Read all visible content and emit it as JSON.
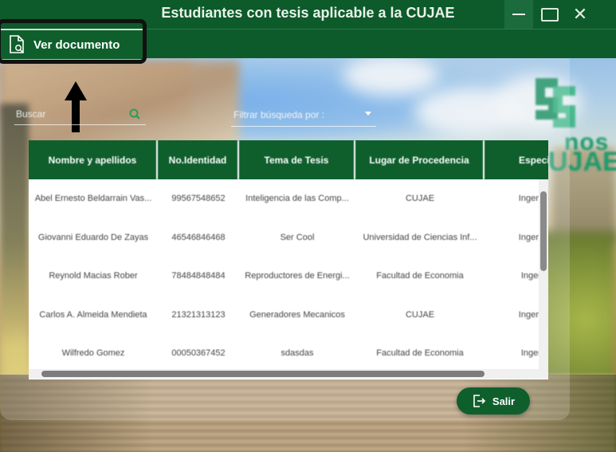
{
  "window": {
    "title": "Estudiantes con tesis aplicable a la CUJAE",
    "close_glyph": "✕"
  },
  "menu": {
    "item_label": "Ver documento",
    "item_icon": "document-search-icon"
  },
  "logo": {
    "line1": "nos",
    "line2": "UJAE"
  },
  "search": {
    "placeholder": "Buscar",
    "icon": "search-icon"
  },
  "filter": {
    "placeholder": "Filtrar búsqueda por :"
  },
  "table": {
    "columns": [
      "Nombre y apellidos",
      "No.Identidad",
      "Tema de Tesis",
      "Lugar de Procedencia",
      "Especiali"
    ],
    "rows": [
      [
        "Abel Ernesto Beldarrain Vas...",
        "99567548652",
        "Inteligencia de las Comp...",
        "CUJAE",
        "Ingenieria I"
      ],
      [
        "Giovanni Eduardo De Zayas",
        "46546846468",
        "Ser Cool",
        "Universidad de Ciencias Inf...",
        "Ingenieria I"
      ],
      [
        "Reynold Macias Rober",
        "78484848484",
        "Reproductores de Energi...",
        "Facultad de Economia",
        "Ingenieria"
      ],
      [
        "Carlos A. Almeida Mendieta",
        "21321313123",
        "Generadores Mecanicos",
        "CUJAE",
        "Ingenieria I"
      ],
      [
        "Wilfredo Gomez",
        "00050367452",
        "sdasdas",
        "Facultad de Economia",
        "Ingenieria"
      ]
    ]
  },
  "exit_button": {
    "label": "Salir"
  },
  "colors": {
    "primary_green": "#0f5f2d",
    "logo_green": "#1d9a6c"
  }
}
